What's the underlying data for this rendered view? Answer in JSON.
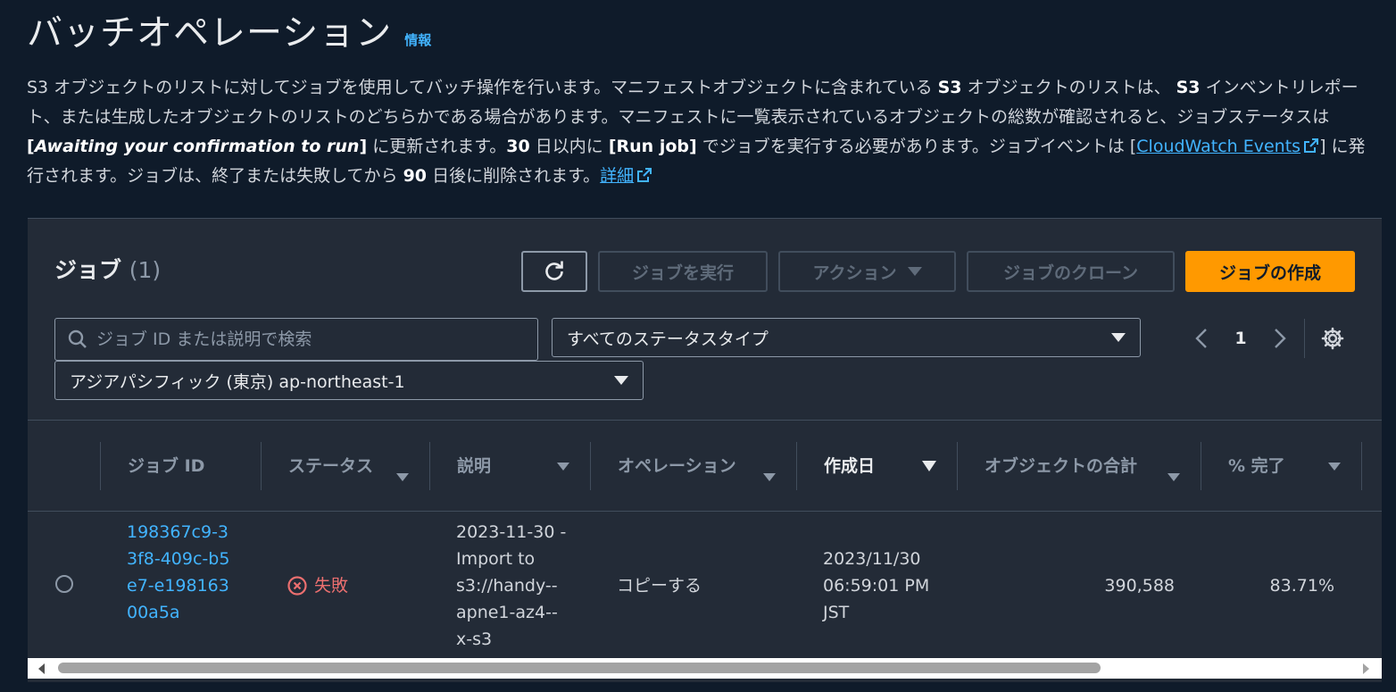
{
  "header": {
    "title": "バッチオペレーション",
    "info_link": "情報"
  },
  "description": {
    "part1": "S3 オブジェクトのリストに対してジョブを使用してバッチ操作を行います。マニフェストオブジェクトに含まれている ",
    "s3_a": "S3",
    "part2": " オブジェクトのリストは、 ",
    "s3_b": "S3",
    "part3": " インベントリレポート、または生成したオブジェクトのリストのどちらかである場合があります。マニフェストに一覧表示されているオブジェクトの総数が確認されると、ジョブステータスは ",
    "awaiting_prefix": "[",
    "awaiting": "Awaiting your confirmation to run",
    "awaiting_suffix": "]",
    "part4": " に更新されます。",
    "days30": "30",
    "part5": " 日以内に ",
    "run_job": "[Run job]",
    "part6": " でジョブを実行する必要があります。ジョブイベントは [",
    "cloudwatch_link": "CloudWatch Events",
    "part7": "] に発行されます。ジョブは、終了または失敗してから ",
    "days90": "90",
    "part8": " 日後に削除されます。",
    "details_link": "詳細"
  },
  "jobs_panel": {
    "title": "ジョブ",
    "count": "(1)",
    "buttons": {
      "run": "ジョブを実行",
      "actions": "アクション",
      "clone": "ジョブのクローン",
      "create": "ジョブの作成"
    },
    "search_placeholder": "ジョブ ID または説明で検索",
    "status_filter": "すべてのステータスタイプ",
    "region_filter": "アジアパシフィック (東京) ap-northeast-1",
    "page_number": "1"
  },
  "table": {
    "columns": {
      "job_id": "ジョブ ID",
      "status": "ステータス",
      "description": "説明",
      "operation": "オペレーション",
      "created": "作成日",
      "total_objects": "オブジェクトの合計",
      "percent_complete": "% 完了"
    },
    "rows": [
      {
        "job_id": "198367c9-33f8-409c-b5e7-e19816300a5a",
        "status": "失敗",
        "description": "2023-11-30 - Import to s3://handy--apne1-az4--x-s3",
        "operation": "コピーする",
        "created": "2023/11/30 06:59:01 PM JST",
        "total_objects": "390,588",
        "percent_complete": "83.71%"
      }
    ]
  },
  "colors": {
    "background": "#0f1b2a",
    "panel": "#232b37",
    "link": "#42b4ff",
    "primary_button": "#ff9900",
    "error": "#eb6f6f"
  }
}
